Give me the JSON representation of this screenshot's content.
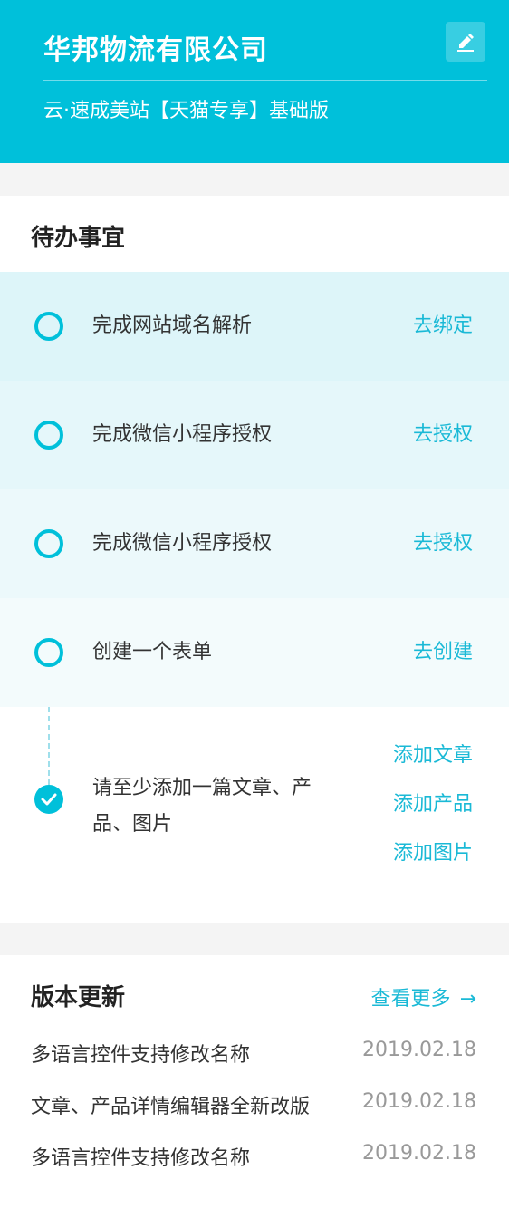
{
  "header": {
    "company_name": "华邦物流有限公司",
    "plan_name": "云·速成美站【天猫专享】基础版",
    "edit_icon": "edit-icon",
    "accent_color": "#00c0da"
  },
  "todo": {
    "title": "待办事宜",
    "items": [
      {
        "text": "完成网站域名解析",
        "action": "去绑定",
        "done": false
      },
      {
        "text": "完成微信小程序授权",
        "action": "去授权",
        "done": false
      },
      {
        "text": "完成微信小程序授权",
        "action": "去授权",
        "done": false
      },
      {
        "text": "创建一个表单",
        "action": "去创建",
        "done": false
      }
    ],
    "last_item": {
      "text": "请至少添加一篇文章、产品、图片",
      "done": true,
      "actions": [
        "添加文章",
        "添加产品",
        "添加图片"
      ]
    }
  },
  "updates": {
    "title": "版本更新",
    "view_more": "查看更多",
    "view_more_icon": "→",
    "items": [
      {
        "title": "多语言控件支持修改名称",
        "date": "2019.02.18"
      },
      {
        "title": "文章、产品详情编辑器全新改版",
        "date": "2019.02.18"
      },
      {
        "title": "多语言控件支持修改名称",
        "date": "2019.02.18"
      }
    ]
  }
}
